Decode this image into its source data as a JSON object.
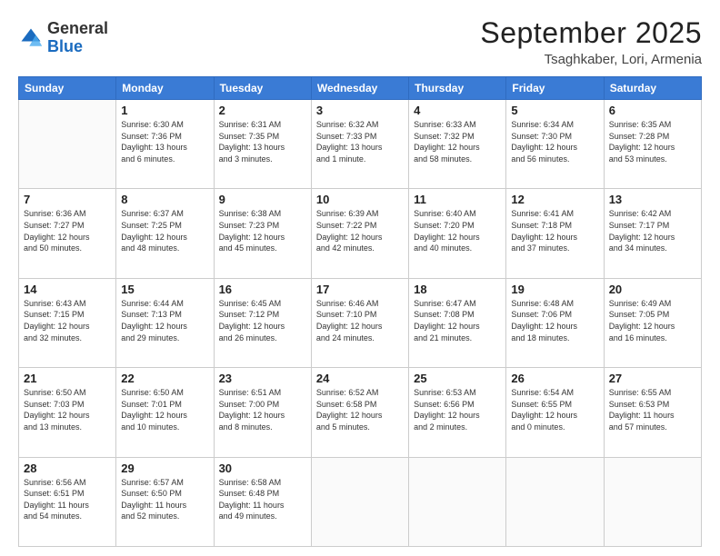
{
  "logo": {
    "general": "General",
    "blue": "Blue"
  },
  "header": {
    "month": "September 2025",
    "location": "Tsaghkaber, Lori, Armenia"
  },
  "weekdays": [
    "Sunday",
    "Monday",
    "Tuesday",
    "Wednesday",
    "Thursday",
    "Friday",
    "Saturday"
  ],
  "weeks": [
    [
      {
        "day": "",
        "info": ""
      },
      {
        "day": "1",
        "info": "Sunrise: 6:30 AM\nSunset: 7:36 PM\nDaylight: 13 hours\nand 6 minutes."
      },
      {
        "day": "2",
        "info": "Sunrise: 6:31 AM\nSunset: 7:35 PM\nDaylight: 13 hours\nand 3 minutes."
      },
      {
        "day": "3",
        "info": "Sunrise: 6:32 AM\nSunset: 7:33 PM\nDaylight: 13 hours\nand 1 minute."
      },
      {
        "day": "4",
        "info": "Sunrise: 6:33 AM\nSunset: 7:32 PM\nDaylight: 12 hours\nand 58 minutes."
      },
      {
        "day": "5",
        "info": "Sunrise: 6:34 AM\nSunset: 7:30 PM\nDaylight: 12 hours\nand 56 minutes."
      },
      {
        "day": "6",
        "info": "Sunrise: 6:35 AM\nSunset: 7:28 PM\nDaylight: 12 hours\nand 53 minutes."
      }
    ],
    [
      {
        "day": "7",
        "info": "Sunrise: 6:36 AM\nSunset: 7:27 PM\nDaylight: 12 hours\nand 50 minutes."
      },
      {
        "day": "8",
        "info": "Sunrise: 6:37 AM\nSunset: 7:25 PM\nDaylight: 12 hours\nand 48 minutes."
      },
      {
        "day": "9",
        "info": "Sunrise: 6:38 AM\nSunset: 7:23 PM\nDaylight: 12 hours\nand 45 minutes."
      },
      {
        "day": "10",
        "info": "Sunrise: 6:39 AM\nSunset: 7:22 PM\nDaylight: 12 hours\nand 42 minutes."
      },
      {
        "day": "11",
        "info": "Sunrise: 6:40 AM\nSunset: 7:20 PM\nDaylight: 12 hours\nand 40 minutes."
      },
      {
        "day": "12",
        "info": "Sunrise: 6:41 AM\nSunset: 7:18 PM\nDaylight: 12 hours\nand 37 minutes."
      },
      {
        "day": "13",
        "info": "Sunrise: 6:42 AM\nSunset: 7:17 PM\nDaylight: 12 hours\nand 34 minutes."
      }
    ],
    [
      {
        "day": "14",
        "info": "Sunrise: 6:43 AM\nSunset: 7:15 PM\nDaylight: 12 hours\nand 32 minutes."
      },
      {
        "day": "15",
        "info": "Sunrise: 6:44 AM\nSunset: 7:13 PM\nDaylight: 12 hours\nand 29 minutes."
      },
      {
        "day": "16",
        "info": "Sunrise: 6:45 AM\nSunset: 7:12 PM\nDaylight: 12 hours\nand 26 minutes."
      },
      {
        "day": "17",
        "info": "Sunrise: 6:46 AM\nSunset: 7:10 PM\nDaylight: 12 hours\nand 24 minutes."
      },
      {
        "day": "18",
        "info": "Sunrise: 6:47 AM\nSunset: 7:08 PM\nDaylight: 12 hours\nand 21 minutes."
      },
      {
        "day": "19",
        "info": "Sunrise: 6:48 AM\nSunset: 7:06 PM\nDaylight: 12 hours\nand 18 minutes."
      },
      {
        "day": "20",
        "info": "Sunrise: 6:49 AM\nSunset: 7:05 PM\nDaylight: 12 hours\nand 16 minutes."
      }
    ],
    [
      {
        "day": "21",
        "info": "Sunrise: 6:50 AM\nSunset: 7:03 PM\nDaylight: 12 hours\nand 13 minutes."
      },
      {
        "day": "22",
        "info": "Sunrise: 6:50 AM\nSunset: 7:01 PM\nDaylight: 12 hours\nand 10 minutes."
      },
      {
        "day": "23",
        "info": "Sunrise: 6:51 AM\nSunset: 7:00 PM\nDaylight: 12 hours\nand 8 minutes."
      },
      {
        "day": "24",
        "info": "Sunrise: 6:52 AM\nSunset: 6:58 PM\nDaylight: 12 hours\nand 5 minutes."
      },
      {
        "day": "25",
        "info": "Sunrise: 6:53 AM\nSunset: 6:56 PM\nDaylight: 12 hours\nand 2 minutes."
      },
      {
        "day": "26",
        "info": "Sunrise: 6:54 AM\nSunset: 6:55 PM\nDaylight: 12 hours\nand 0 minutes."
      },
      {
        "day": "27",
        "info": "Sunrise: 6:55 AM\nSunset: 6:53 PM\nDaylight: 11 hours\nand 57 minutes."
      }
    ],
    [
      {
        "day": "28",
        "info": "Sunrise: 6:56 AM\nSunset: 6:51 PM\nDaylight: 11 hours\nand 54 minutes."
      },
      {
        "day": "29",
        "info": "Sunrise: 6:57 AM\nSunset: 6:50 PM\nDaylight: 11 hours\nand 52 minutes."
      },
      {
        "day": "30",
        "info": "Sunrise: 6:58 AM\nSunset: 6:48 PM\nDaylight: 11 hours\nand 49 minutes."
      },
      {
        "day": "",
        "info": ""
      },
      {
        "day": "",
        "info": ""
      },
      {
        "day": "",
        "info": ""
      },
      {
        "day": "",
        "info": ""
      }
    ]
  ]
}
